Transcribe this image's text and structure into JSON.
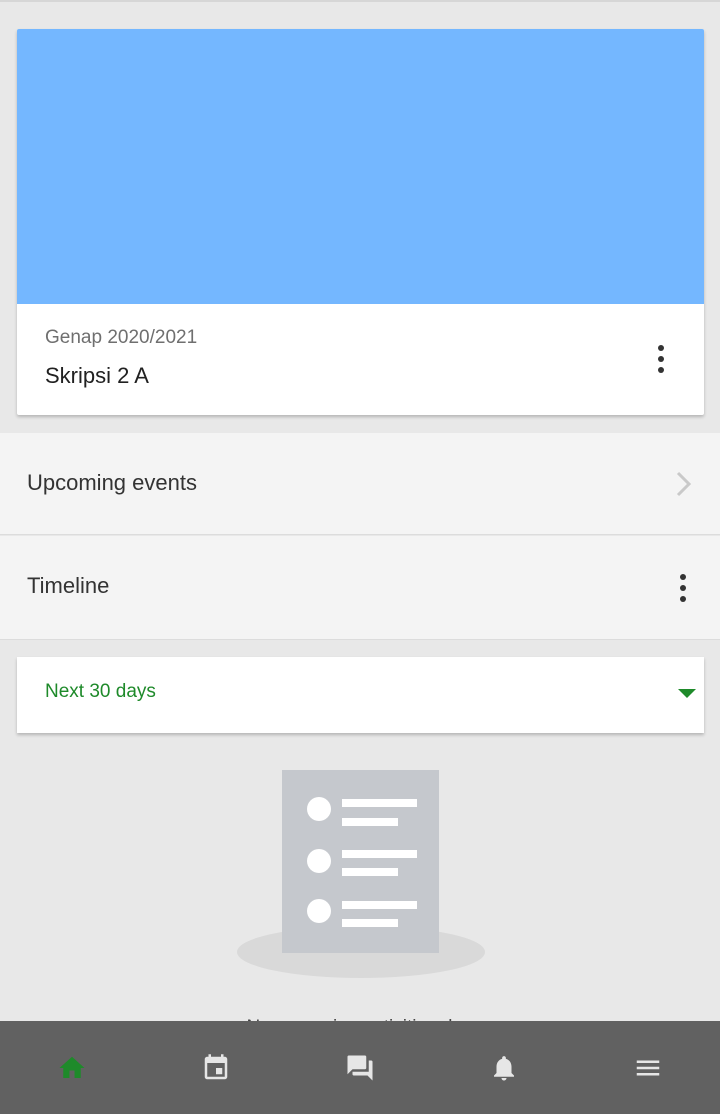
{
  "colors": {
    "course_banner": "#74b7ff",
    "accent_green": "#1e8a2a",
    "nav_bar": "#616161",
    "nav_icon": "#e6e6e6"
  },
  "course": {
    "term": "Genap 2020/2021",
    "name": "Skripsi 2 A"
  },
  "upcoming": {
    "label": "Upcoming events"
  },
  "timeline": {
    "label": "Timeline"
  },
  "filter": {
    "selected": "Next 30 days"
  },
  "empty_state": {
    "message": "No upcoming activities due"
  },
  "bottom_nav": [
    {
      "icon": "home-icon",
      "active": true
    },
    {
      "icon": "calendar-icon",
      "active": false
    },
    {
      "icon": "messages-icon",
      "active": false
    },
    {
      "icon": "bell-icon",
      "active": false
    },
    {
      "icon": "menu-icon",
      "active": false
    }
  ]
}
